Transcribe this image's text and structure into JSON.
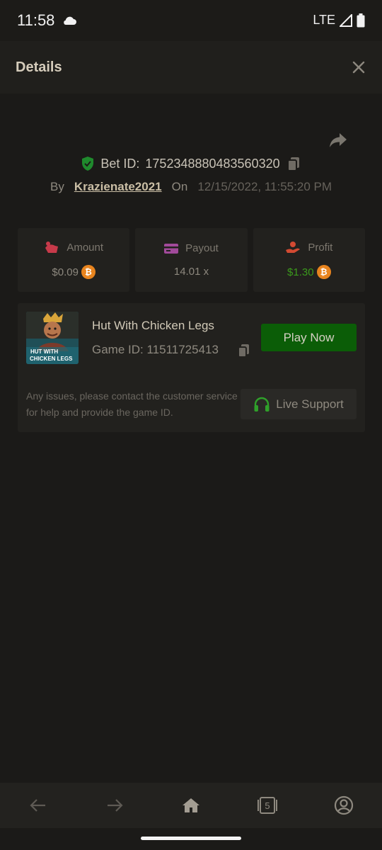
{
  "status_bar": {
    "time": "11:58",
    "network": "LTE"
  },
  "header": {
    "title": "Details"
  },
  "bet": {
    "id_label": "Bet ID:",
    "id_value": "1752348880483560320",
    "by_label": "By",
    "username": "Krazienate2021",
    "on_label": "On",
    "date": "12/15/2022, 11:55:20 PM"
  },
  "stats": {
    "amount": {
      "label": "Amount",
      "value": "$0.09"
    },
    "payout": {
      "label": "Payout",
      "value": "14.01 x"
    },
    "profit": {
      "label": "Profit",
      "value": "$1.30"
    }
  },
  "game": {
    "title": "Hut With Chicken Legs",
    "id_text": "Game ID: 11511725413",
    "thumb_text_1": "HUT WITH",
    "thumb_text_2": "CHICKEN LEGS",
    "play_label": "Play Now",
    "issues_text": "Any issues, please contact the customer service for help and provide the game ID.",
    "support_label": "Live Support"
  },
  "nav": {
    "tabs_count": "5"
  },
  "colors": {
    "accent_green": "#0b5d07",
    "profit_green": "#3b9a1c",
    "bitcoin_orange": "#e8841e"
  }
}
